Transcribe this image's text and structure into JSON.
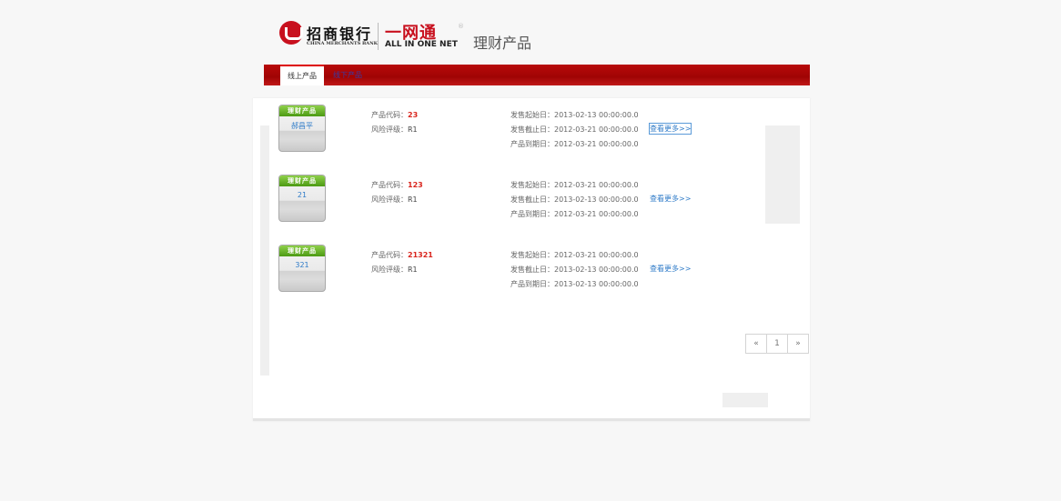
{
  "header": {
    "bank_name_cn": "招商银行",
    "bank_name_en": "CHINA MERCHANTS BANK",
    "brand_cn": "一网通",
    "brand_en": "ALL IN ONE NET",
    "registered_mark": "®",
    "section_title": "理财产品"
  },
  "tabs": [
    {
      "label": "线上产品",
      "active": true
    },
    {
      "label": "线下产品",
      "active": false
    }
  ],
  "products": [
    {
      "badge": "理财产品",
      "name": "郝昌平",
      "code_label": "产品代码：",
      "code": "23",
      "risk_label": "风险评级：",
      "risk": "R1",
      "sale_start_label": "发售起始日：",
      "sale_start": "2013-02-13 00:00:00.0",
      "sale_end_label": "发售截止日：",
      "sale_end": "2012-03-21 00:00:00.0",
      "maturity_label": "产品到期日：",
      "maturity": "2012-03-21 00:00:00.0",
      "more_label": "查看更多>>"
    },
    {
      "badge": "理财产品",
      "name": "21",
      "code_label": "产品代码：",
      "code": "123",
      "risk_label": "风险评级：",
      "risk": "R1",
      "sale_start_label": "发售起始日：",
      "sale_start": "2012-03-21 00:00:00.0",
      "sale_end_label": "发售截止日：",
      "sale_end": "2013-02-13 00:00:00.0",
      "maturity_label": "产品到期日：",
      "maturity": "2012-03-21 00:00:00.0",
      "more_label": "查看更多>>"
    },
    {
      "badge": "理财产品",
      "name": "321",
      "code_label": "产品代码：",
      "code": "21321",
      "risk_label": "风险评级：",
      "risk": "R1",
      "sale_start_label": "发售起始日：",
      "sale_start": "2012-03-21 00:00:00.0",
      "sale_end_label": "发售截止日：",
      "sale_end": "2013-02-13 00:00:00.0",
      "maturity_label": "产品到期日：",
      "maturity": "2013-02-13 00:00:00.0",
      "more_label": "查看更多>>"
    }
  ],
  "pagination": {
    "prev": "«",
    "page": "1",
    "next": "»"
  },
  "colors": {
    "brand_red": "#c8101e",
    "code_red": "#d9251d",
    "link_blue": "#2f7bc8",
    "badge_green": "#4c9a14"
  }
}
